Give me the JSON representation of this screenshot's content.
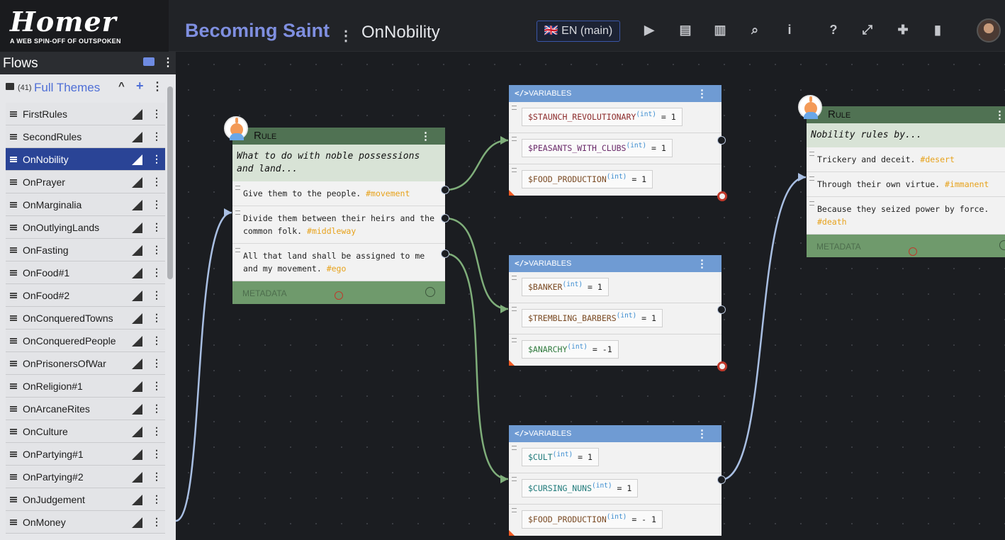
{
  "header": {
    "logo": "Homer",
    "logo_subtitle": "A WEB SPIN-OFF OF OUTSPOKEN",
    "project_title": "Becoming Saint",
    "flow_title": "OnNobility",
    "language_button": "🇬🇧 EN (main)",
    "toolbar_icons": [
      "play-icon",
      "document-icon",
      "map-icon",
      "search-icon",
      "info-icon",
      "help-icon",
      "expand-icon",
      "add-user-icon",
      "book-icon"
    ]
  },
  "sidebar": {
    "title": "Flows",
    "folder": {
      "count": "(41)",
      "name": "Full Themes"
    },
    "items": [
      {
        "label": "FirstRules"
      },
      {
        "label": "SecondRules"
      },
      {
        "label": "OnNobility",
        "active": true
      },
      {
        "label": "OnPrayer"
      },
      {
        "label": "OnMarginalia"
      },
      {
        "label": "OnOutlyingLands"
      },
      {
        "label": "OnFasting"
      },
      {
        "label": "OnFood#1"
      },
      {
        "label": "OnFood#2"
      },
      {
        "label": "OnConqueredTowns"
      },
      {
        "label": "OnConqueredPeople"
      },
      {
        "label": "OnPrisonersOfWar"
      },
      {
        "label": "OnReligion#1"
      },
      {
        "label": "OnArcaneRites"
      },
      {
        "label": "OnCulture"
      },
      {
        "label": "OnPartying#1"
      },
      {
        "label": "OnPartying#2"
      },
      {
        "label": "OnJudgement"
      },
      {
        "label": "OnMoney"
      }
    ]
  },
  "nodes": {
    "rule1": {
      "type_label": "Rule",
      "question": "What to do with noble possessions and land...",
      "choices": [
        {
          "text": "Give them to the people. ",
          "tag": "#movement"
        },
        {
          "text": "Divide them between their heirs and the common folk. ",
          "tag": "#middleway"
        },
        {
          "text": "All that land shall be assigned to me and my movement. ",
          "tag": "#ego"
        }
      ],
      "meta_label": "METADATA"
    },
    "vars1": {
      "type_label": "VARIABLES",
      "rows": [
        {
          "name": "$STAUNCH_REVOLUTIONARY",
          "type": "(int)",
          "op": " = 1",
          "color": "#8c2b2b"
        },
        {
          "name": "$PEASANTS_WITH_CLUBS",
          "type": "(int)",
          "op": " = 1",
          "color": "#6a2a6a"
        },
        {
          "name": "$FOOD_PRODUCTION",
          "type": "(int)",
          "op": " = 1",
          "color": "#7a4a23"
        }
      ]
    },
    "vars2": {
      "type_label": "VARIABLES",
      "rows": [
        {
          "name": "$BANKER",
          "type": "(int)",
          "op": " = 1",
          "color": "#7a4a23"
        },
        {
          "name": "$TREMBLING_BARBERS",
          "type": "(int)",
          "op": " = 1",
          "color": "#7a4a23"
        },
        {
          "name": "$ANARCHY",
          "type": "(int)",
          "op": " = -1",
          "color": "#2f7a3d"
        }
      ]
    },
    "vars3": {
      "type_label": "VARIABLES",
      "rows": [
        {
          "name": "$CULT",
          "type": "(int)",
          "op": " = 1",
          "color": "#1f7a7a"
        },
        {
          "name": "$CURSING_NUNS",
          "type": "(int)",
          "op": " = 1",
          "color": "#1f7a7a"
        },
        {
          "name": "$FOOD_PRODUCTION",
          "type": "(int)",
          "op": " = - 1",
          "color": "#7a4a23"
        }
      ]
    },
    "rule2": {
      "type_label": "Rule",
      "question": "Nobility rules by...",
      "choices": [
        {
          "text": "Trickery and deceit. ",
          "tag": "#desert"
        },
        {
          "text": "Through their own virtue. ",
          "tag": "#immanent"
        },
        {
          "text": "Because they seized power by force. ",
          "tag": "#death"
        }
      ],
      "meta_label": "METADATA"
    }
  },
  "colors": {
    "rule_header": "#507253",
    "rule_meta": "#6f9a6c",
    "variables_header": "#6f9bd3",
    "active_flow": "#2a4496",
    "project_title": "#7f8fe0",
    "tag": "#e7a21b",
    "wire_green": "#7fae7a",
    "wire_blue": "#a9bfe3"
  }
}
